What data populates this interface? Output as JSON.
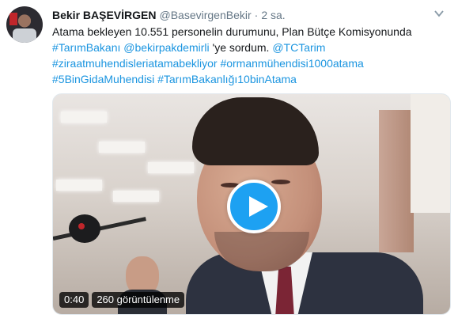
{
  "tweet": {
    "display_name": "Bekir BAŞEVİRGEN",
    "handle": "@BasevirgenBekir",
    "separator": "·",
    "time": "2 sa.",
    "text": {
      "line1": "Atama bekleyen 10.551 personelin durumunu, Plan Bütçe Komisyonunda",
      "line2_link1": "#TarımBakanı",
      "line2_link2": "@bekirpakdemirli",
      "line2_text": " 'ye sordum. ",
      "line2_link3": "@TCTarim",
      "line3_link1": "#ziraatmuhendisleriatamabekliyor",
      "line3_link2": "#ormanmühendisi1000atama",
      "line4_link1": "#5BinGidaMuhendisi",
      "line4_link2": "#TarımBakanlığı10binAtama"
    }
  },
  "video": {
    "duration": "0:40",
    "views": "260 görüntülenme",
    "play_icon": "play-icon"
  },
  "colors": {
    "link": "#1b95e0",
    "play_button": "#1da1f2",
    "text": "#14171a",
    "muted": "#657786"
  }
}
